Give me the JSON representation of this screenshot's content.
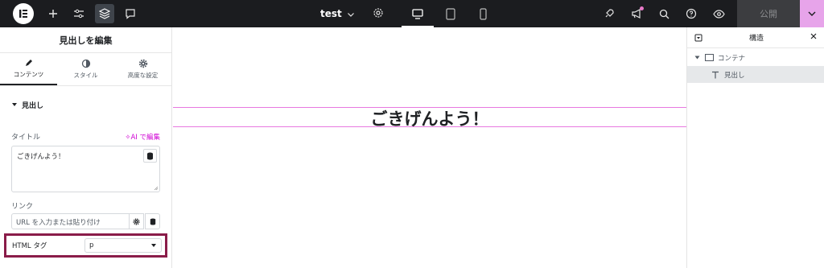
{
  "topbar": {
    "doc_name": "test",
    "publish_label": "公開",
    "icons": [
      "elementor-logo-icon",
      "plus-icon",
      "sliders-icon",
      "layers-icon",
      "chat-icon",
      "chevron-down-icon",
      "gear-icon",
      "desktop-icon",
      "tablet-icon",
      "mobile-icon",
      "rocket-icon",
      "megaphone-icon",
      "search-icon",
      "help-icon",
      "eye-icon"
    ],
    "accent_color": "#e7a4ea"
  },
  "panel": {
    "title": "見出しを編集",
    "tabs": [
      {
        "label": "コンテンツ",
        "icon": "pencil-icon"
      },
      {
        "label": "スタイル",
        "icon": "half-circle-icon"
      },
      {
        "label": "高度な設定",
        "icon": "gear-icon"
      }
    ],
    "section_title": "見出し",
    "title_label": "タイトル",
    "ai_edit_label": "AI で編集",
    "title_value": "ごきげんよう！",
    "link_label": "リンク",
    "link_placeholder": "URL を入力または貼り付け",
    "html_tag_label": "HTML タグ",
    "html_tag_value": "p",
    "highlight_color": "#8a1c49"
  },
  "canvas": {
    "heading_text": "ごきげんよう！"
  },
  "structure": {
    "title": "構造",
    "items": [
      {
        "label": "コンテナ",
        "icon": "container-icon"
      },
      {
        "label": "見出し",
        "icon": "text-icon"
      }
    ]
  }
}
